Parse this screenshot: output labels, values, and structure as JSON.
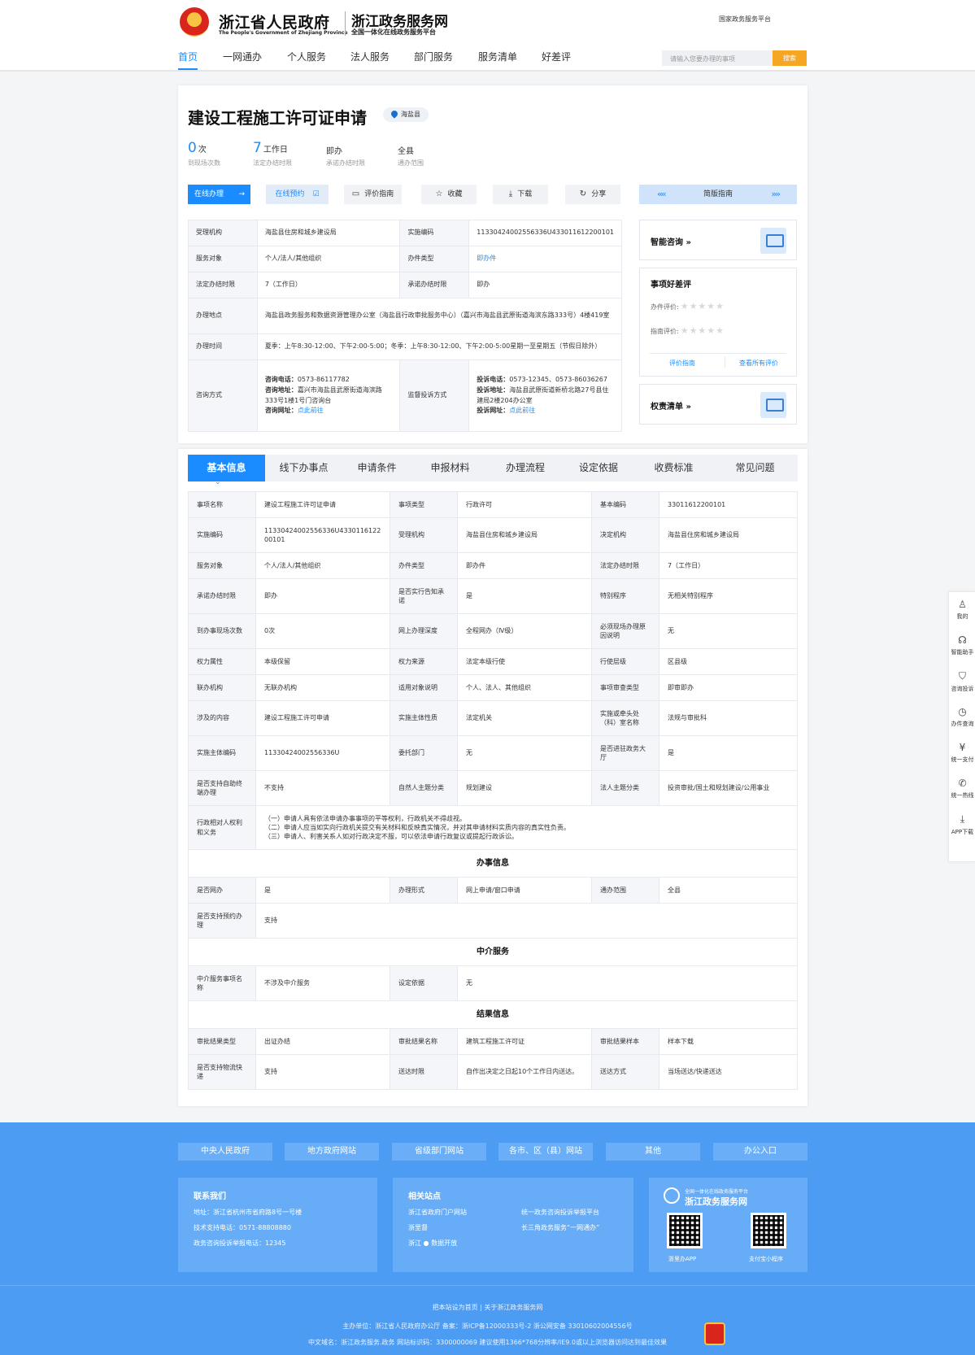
{
  "header": {
    "gov_cn": "浙江省人民政府",
    "gov_en": "The People's Government of Zhejiang Province",
    "portal_cn": "浙江政务服务网",
    "portal_sub": "全国一体化在线政务服务平台",
    "national_link": "国家政务服务平台",
    "nav": [
      "首页",
      "一网通办",
      "个人服务",
      "法人服务",
      "部门服务",
      "服务清单",
      "好差评"
    ],
    "search_placeholder": "请输入您要办理的事项",
    "search_btn": "搜索"
  },
  "item": {
    "title": "建设工程施工许可证申请",
    "location": "海盐县",
    "stats": [
      {
        "num": "0",
        "unit": "次",
        "label": "到现场次数"
      },
      {
        "num": "7",
        "unit": "工作日",
        "label": "法定办结时限"
      },
      {
        "val": "即办",
        "label": "承诺办结时限"
      },
      {
        "val": "全县",
        "label": "通办范围"
      }
    ],
    "buttons": {
      "online": "在线办理",
      "reserve": "在线预约",
      "eval_guide": "评价指南",
      "collect": "收藏",
      "download": "下载",
      "share": "分享",
      "brief_guide": "简版指南"
    },
    "info": {
      "k_org": "受理机构",
      "v_org": "海盐县住房和城乡建设局",
      "k_code": "实施编码",
      "v_code": "11330424002556336U433011612200101",
      "k_target": "服务对象",
      "v_target": "个人/法人/其他组织",
      "k_type": "办件类型",
      "v_type": "即办件",
      "k_legal": "法定办结时限",
      "v_legal": "7（工作日）",
      "k_promise": "承诺办结时限",
      "v_promise": "即办",
      "k_place": "办理地点",
      "v_place": "海盐县政务服务和数据资源管理办公室（海盐县行政审批服务中心）（嘉兴市海盐县武原街道海滨东路333号）4楼419室",
      "k_time": "办理时间",
      "v_time": "夏季：上午8:30-12:00、下午2:00-5:00；冬季：上午8:30-12:00、下午2:00-5:00星期一至星期五（节假日除外）",
      "k_contact": "咨询方式",
      "c_phone_k": "咨询电话：",
      "c_phone_v": "0573-86117782",
      "c_addr_k": "咨询地址：",
      "c_addr_v": "嘉兴市海盐县武原街道海滨路333号1楼1号门咨询台",
      "c_web_k": "咨询网址：",
      "c_web_v": "点此前往",
      "k_complaint": "监督投诉方式",
      "t_phone_k": "投诉电话：",
      "t_phone_v": "0573-12345、0573-86036267",
      "t_addr_k": "投诉地址：",
      "t_addr_v": "海盐县武原街道新桥北路27号县住建局2楼204办公室",
      "t_web_k": "投诉网址：",
      "t_web_v": "点此前往"
    },
    "side": {
      "consult": "智能咨询 »",
      "rating_title": "事项好差评",
      "rating_case": "办件评价:",
      "rating_guide": "指南评价:",
      "stars": "★★★★★",
      "rate_link1": "评价指南",
      "rate_link2": "查看所有评价",
      "power": "权责清单 »"
    }
  },
  "tabs": [
    "基本信息",
    "线下办事点",
    "申请条件",
    "申报材料",
    "办理流程",
    "设定依据",
    "收费标准",
    "常见问题"
  ],
  "detail": {
    "r1": [
      "事项名称",
      "建设工程施工许可证申请",
      "事项类型",
      "行政许可",
      "基本编码",
      "33011612200101"
    ],
    "r2": [
      "实施编码",
      "11330424002556336U433011612200101",
      "受理机构",
      "海盐县住房和城乡建设局",
      "决定机构",
      "海盐县住房和城乡建设局"
    ],
    "r3": [
      "服务对象",
      "个人/法人/其他组织",
      "办件类型",
      "即办件",
      "法定办结时限",
      "7（工作日）"
    ],
    "r4": [
      "承诺办结时限",
      "即办",
      "是否实行告知承诺",
      "是",
      "特别程序",
      "无相关特别程序"
    ],
    "r5": [
      "到办事现场次数",
      "0次",
      "网上办理深度",
      "全程网办（Ⅳ级）",
      "必须现场办理原因说明",
      "无"
    ],
    "r6": [
      "权力属性",
      "本级保留",
      "权力来源",
      "法定本级行使",
      "行使层级",
      "区县级"
    ],
    "r7": [
      "联办机构",
      "无联办机构",
      "适用对象说明",
      "个人、法人、其他组织",
      "事项审查类型",
      "即审即办"
    ],
    "r8": [
      "涉及的内容",
      "建设工程施工许可申请",
      "实施主体性质",
      "法定机关",
      "实施或牵头处（科）室名称",
      "法规与审批科"
    ],
    "r9": [
      "实施主体编码",
      "11330424002556336U",
      "委托部门",
      "无",
      "是否进驻政务大厅",
      "是"
    ],
    "r10": [
      "是否支持自助终端办理",
      "不支持",
      "自然人主题分类",
      "规划建设",
      "法人主题分类",
      "投资审批/国土和规划建设/公用事业"
    ],
    "r11_k": "行政相对人权利和义务",
    "r11_v1": "（一）申请人具有依法申请办事事项的平等权利，行政机关不得歧视。",
    "r11_v2": "（二）申请人应当如实向行政机关提交有关材料和反映真实情况，并对其申请材料实质内容的真实性负责。",
    "r11_v3": "（三）申请人、利害关系人如对行政决定不服，可以依法申请行政复议或提起行政诉讼。",
    "sec_handle": "办事信息",
    "h1": [
      "是否网办",
      "是",
      "办理形式",
      "网上申请/窗口申请",
      "通办范围",
      "全县"
    ],
    "h2": [
      "是否支持预约办理",
      "支持"
    ],
    "sec_agency": "中介服务",
    "a1": [
      "中介服务事项名称",
      "不涉及中介服务",
      "设定依据",
      "无"
    ],
    "sec_result": "结果信息",
    "res1": [
      "审批结果类型",
      "出证办结",
      "审批结果名称",
      "建筑工程施工许可证",
      "审批结果样本",
      "样本下载"
    ],
    "res2": [
      "是否支持物流快递",
      "支持",
      "送达时限",
      "自作出决定之日起10个工作日内送达。",
      "送达方式",
      "当场送达/快递送达"
    ]
  },
  "float_bar": [
    "我的",
    "智能助手",
    "咨询投诉",
    "办件查询",
    "统一支付",
    "统一热线",
    "APP下载"
  ],
  "footer": {
    "links": [
      "中央人民政府",
      "地方政府网站",
      "省级部门网站",
      "各市、区（县）网站",
      "其他",
      "办公入口"
    ],
    "contact_title": "联系我们",
    "contact_addr": "地址：浙江省杭州市省府路8号一号楼",
    "contact_tech": "技术支持电话：0571-88808880",
    "contact_complaint": "政务咨询投诉举报电话：12345",
    "related_title": "相关站点",
    "rel1": "浙江省政府门户网站",
    "rel2": "统一政务咨询投诉举报平台",
    "rel3": "浙里督",
    "rel4": "长三角政务服务“一网通办”",
    "rel5": "浙江 ● 数据开放",
    "app_sub": "全国一体化在线政务服务平台",
    "app_title": "浙江政务服务网",
    "qr1_label": "浙里办APP",
    "qr2_label": "支付宝小程序",
    "bottom1": "把本站设为首页  |  关于浙江政务服务网",
    "bottom2": "主办单位：浙江省人民政府办公厅     备案：浙ICP备12000333号-2     浙公网安备 33010602004556号",
    "bottom3": "中文域名：浙江政务服务.政务     网站标识码：3300000069     建议使用1366*768分辨率/IE9.0或以上浏览器访问达到最佳效果"
  },
  "colors": {
    "accent": "#1a8cff",
    "search_btn": "#f5a623",
    "footer_bg": "#4d9cf4"
  }
}
